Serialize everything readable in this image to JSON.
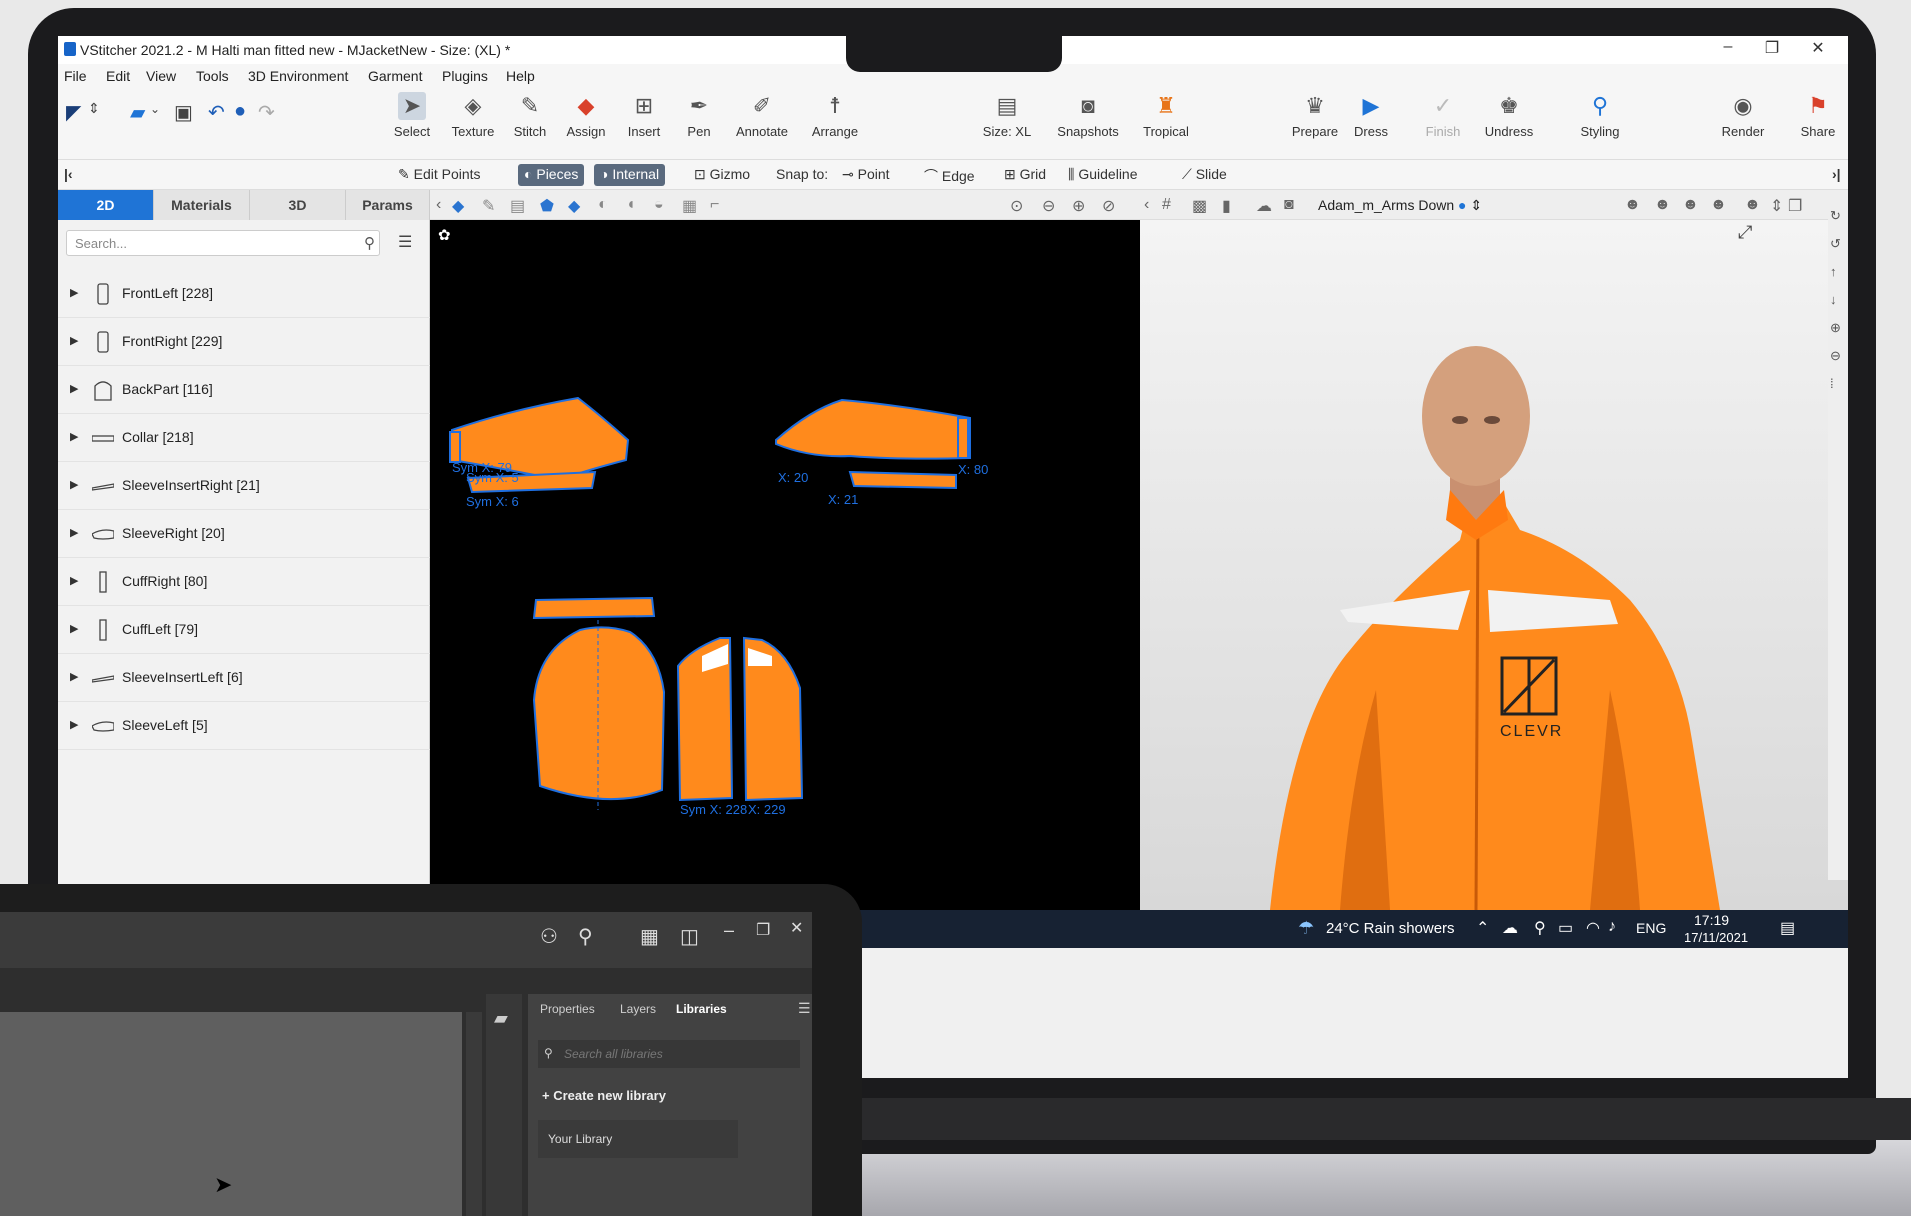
{
  "window": {
    "title": "VStitcher 2021.2 - M Halti man fitted new - MJacketNew - Size: (XL) *"
  },
  "menu": [
    "File",
    "Edit",
    "View",
    "Tools",
    "3D Environment",
    "Garment",
    "Plugins",
    "Help"
  ],
  "toolbar": {
    "tools": [
      {
        "label": "Select",
        "icon": "select-arrow-icon"
      },
      {
        "label": "Texture",
        "icon": "texture-icon"
      },
      {
        "label": "Stitch",
        "icon": "stitch-icon"
      },
      {
        "label": "Assign",
        "icon": "assign-icon"
      },
      {
        "label": "Insert",
        "icon": "insert-icon"
      },
      {
        "label": "Pen",
        "icon": "pen-icon"
      },
      {
        "label": "Annotate",
        "icon": "annotate-icon"
      },
      {
        "label": "Arrange",
        "icon": "arrange-icon"
      },
      {
        "label": "Size: XL",
        "icon": "size-icon"
      },
      {
        "label": "Snapshots",
        "icon": "snapshots-icon"
      },
      {
        "label": "Tropical",
        "icon": "tropical-icon"
      },
      {
        "label": "Prepare",
        "icon": "prepare-icon"
      },
      {
        "label": "Dress",
        "icon": "dress-icon"
      },
      {
        "label": "Finish",
        "icon": "finish-icon"
      },
      {
        "label": "Undress",
        "icon": "undress-icon"
      },
      {
        "label": "Styling",
        "icon": "styling-icon"
      },
      {
        "label": "Render",
        "icon": "render-icon"
      },
      {
        "label": "Share",
        "icon": "share-icon"
      }
    ]
  },
  "toolbar2": {
    "edit_points": "Edit Points",
    "pieces": "Pieces",
    "internal": "Internal",
    "gizmo": "Gizmo",
    "snap_to": "Snap to:",
    "point": "Point",
    "edge": "Edge",
    "grid": "Grid",
    "guideline": "Guideline",
    "slide": "Slide"
  },
  "tabs": [
    "2D",
    "Materials",
    "3D",
    "Params"
  ],
  "search_placeholder": "Search...",
  "avatar_label": "Adam_m_Arms Down",
  "pieces": [
    {
      "label": "FrontLeft [228]"
    },
    {
      "label": "FrontRight [229]"
    },
    {
      "label": "BackPart [116]"
    },
    {
      "label": "Collar [218]"
    },
    {
      "label": "SleeveInsertRight [21]"
    },
    {
      "label": "SleeveRight [20]"
    },
    {
      "label": "CuffRight [80]"
    },
    {
      "label": "CuffLeft [79]"
    },
    {
      "label": "SleeveInsertLeft [6]"
    },
    {
      "label": "SleeveLeft [5]"
    }
  ],
  "pattern_labels": [
    "Sym X: 79",
    "Sym X: 5",
    "Sym X: 6",
    "X: 20",
    "X: 80",
    "X: 21",
    "Sym X: 228",
    "X: 229"
  ],
  "jacket_logo": "CLEVR",
  "taskbar": {
    "weather": "24°C  Rain showers",
    "lang": "ENG",
    "time": "17:19",
    "date": "17/11/2021"
  },
  "tablet": {
    "tabs": [
      "Properties",
      "Layers",
      "Libraries"
    ],
    "search_placeholder": "Search all libraries",
    "create": "Create new library",
    "your_library": "Your Library"
  },
  "colors": {
    "accent": "#1f74d6",
    "garment": "#ff8a1c",
    "taskbar": "#172233"
  }
}
